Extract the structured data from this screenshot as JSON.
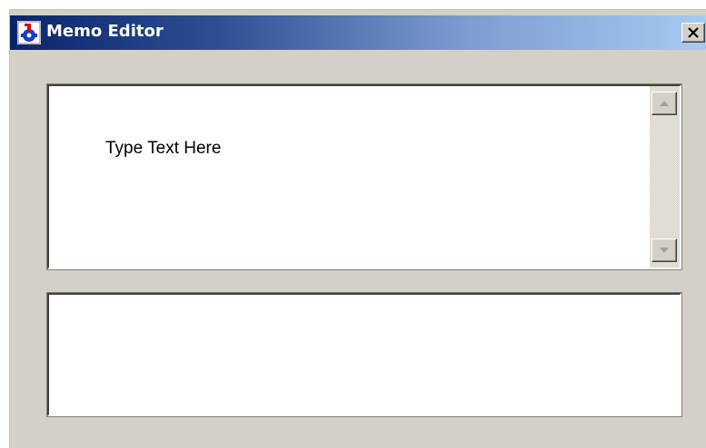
{
  "window": {
    "title": "Memo Editor",
    "icon": "app-logo-icon",
    "close_icon": "close-icon"
  },
  "memo": {
    "text": "Type Text Here",
    "scroll_up_icon": "scroll-up-arrow-icon",
    "scroll_down_icon": "scroll-down-arrow-icon"
  },
  "output": {
    "text": ""
  },
  "colors": {
    "titlebar_start": "#0a246a",
    "titlebar_end": "#a6caf0",
    "window_bg": "#d4d0c8",
    "field_bg": "#ffffff"
  }
}
